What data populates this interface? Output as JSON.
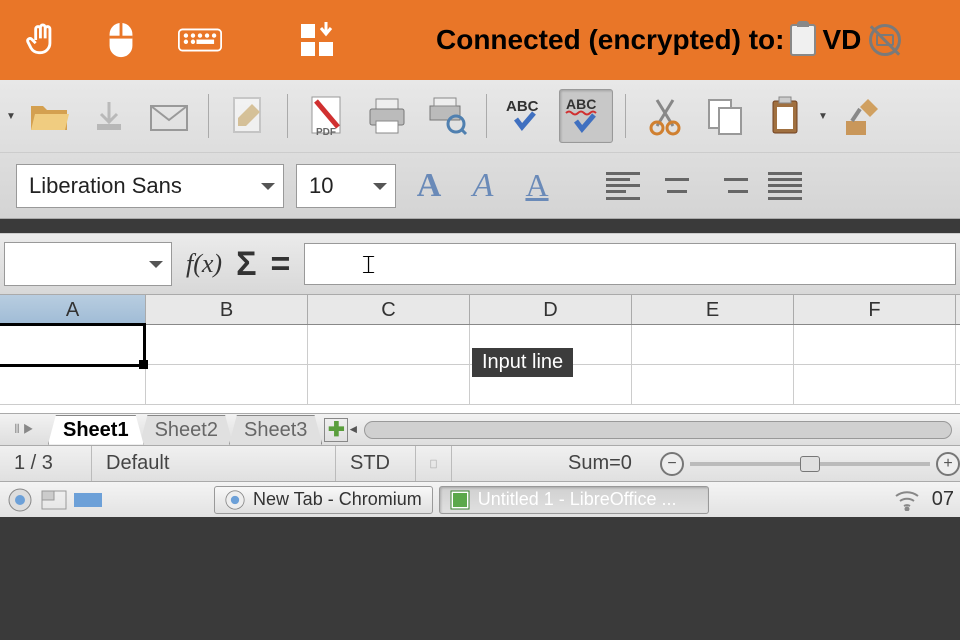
{
  "vnc": {
    "status": "Connected (encrypted) to:",
    "target": "VD"
  },
  "toolbar": {
    "font_name": "Liberation Sans",
    "font_size": "10"
  },
  "formula": {
    "name_box": "",
    "fx_label": "f(x)",
    "input_value": ""
  },
  "tooltip": "Input line",
  "columns": [
    "A",
    "B",
    "C",
    "D",
    "E",
    "F"
  ],
  "sheets": {
    "tabs": [
      "Sheet1",
      "Sheet2",
      "Sheet3"
    ],
    "active_index": 0
  },
  "status": {
    "sheet_pos": "1 / 3",
    "style": "Default",
    "mode": "STD",
    "sum": "Sum=0"
  },
  "taskbar": {
    "chromium": "New Tab - Chromium",
    "calc": "Untitled 1 - LibreOffice ...",
    "time": "07"
  }
}
